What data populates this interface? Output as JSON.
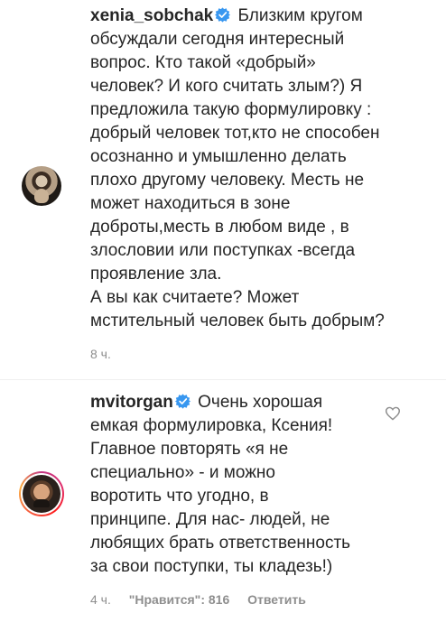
{
  "caption": {
    "username": "xenia_sobchak",
    "text": " Близким кругом\nобсуждали сегодня интересный\nвопрос. Кто такой «добрый»\nчеловек? И кого считать злым?) Я\nпредложила такую формулировку :\nдобрый человек тот,кто не способен\nосознанно и умышленно делать\nплохо другому человеку. Месть не\nможет находиться в зоне\nдоброты,месть в любом виде , в\nзлословии или поступках -всегда\nпроявление зла.\nА вы как считаете? Может\nмстительный человек быть добрым?",
    "time": "8 ч."
  },
  "reply": {
    "username": "mvitorgan",
    "text": " Очень хорошая\nемкая формулировка, Ксения!\nГлавное повторять «я не\nспециально» - и можно\nворотить что угодно, в\nпринципе. Для нас- людей, не\nлюбящих брать ответственность\nза свои поступки, ты кладезь!)",
    "time": "4 ч.",
    "likes_label": "\"Нравится\": 816",
    "reply_label": "Ответить"
  },
  "colors": {
    "text": "#262626",
    "meta": "#8e8e8e",
    "verified": "#3897f0"
  },
  "icons": {
    "verified": "verified-badge-icon",
    "like": "heart-outline-icon"
  }
}
